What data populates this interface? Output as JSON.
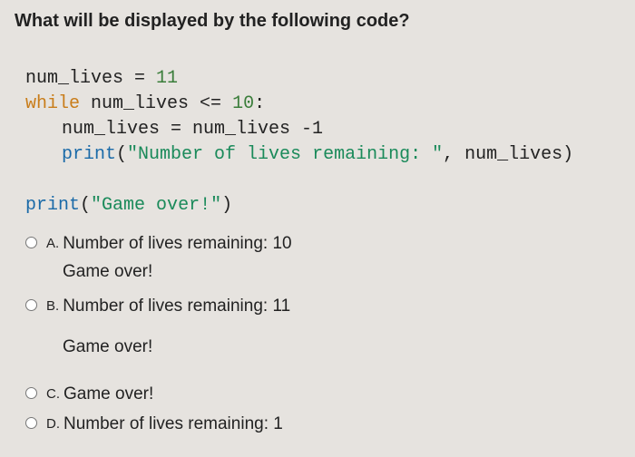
{
  "question": "What will be displayed by the following code?",
  "code": {
    "line1_text": "num_lives = ",
    "line1_num": "11",
    "line2_kw": "while",
    "line2_rest": " num_lives <= ",
    "line2_num": "10",
    "line2_colon": ":",
    "line3_text": "num_lives = num_lives -1",
    "line4_fn": "print",
    "line4_open": "(",
    "line4_str": "\"Number of lives remaining: \"",
    "line4_rest": ", num_lives)",
    "line5_fn": "print",
    "line5_open": "(",
    "line5_str": "\"Game over!\"",
    "line5_close": ")"
  },
  "options": [
    {
      "letter": "A.",
      "line1": "Number of lives remaining: 10",
      "line2": "Game over!"
    },
    {
      "letter": "B.",
      "line1": "Number of lives remaining: 11",
      "line2": "Game over!"
    },
    {
      "letter": "C.",
      "line1": "Game over!",
      "line2": ""
    },
    {
      "letter": "D.",
      "line1": "Number of lives remaining: 1",
      "line2": ""
    }
  ]
}
